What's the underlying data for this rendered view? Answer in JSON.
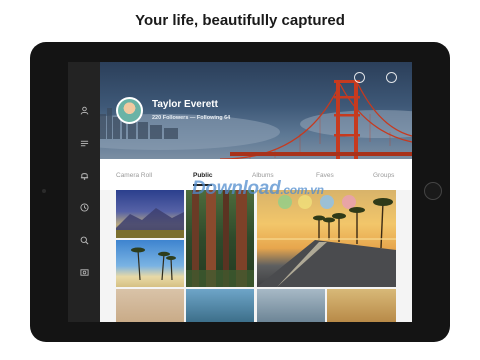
{
  "headline": "Your life, beautifully captured",
  "profile": {
    "name": "Taylor Everett",
    "stats": "220 Followers — Following 64"
  },
  "tabs": [
    {
      "label": "Camera Roll",
      "active": false
    },
    {
      "label": "Public",
      "active": true
    },
    {
      "label": "Albums",
      "active": false
    },
    {
      "label": "Faves",
      "active": false
    },
    {
      "label": "Groups",
      "active": false
    }
  ],
  "watermark": {
    "main": "Download",
    "suffix": ".com.vn"
  },
  "sidebar_icons": [
    "profile-icon",
    "menu-icon",
    "bell-icon",
    "clock-icon",
    "search-icon",
    "photo-icon"
  ],
  "colors": {
    "accent_bridge": "#c63a1f",
    "sidebar": "#232323",
    "tablet_frame": "#141414"
  }
}
